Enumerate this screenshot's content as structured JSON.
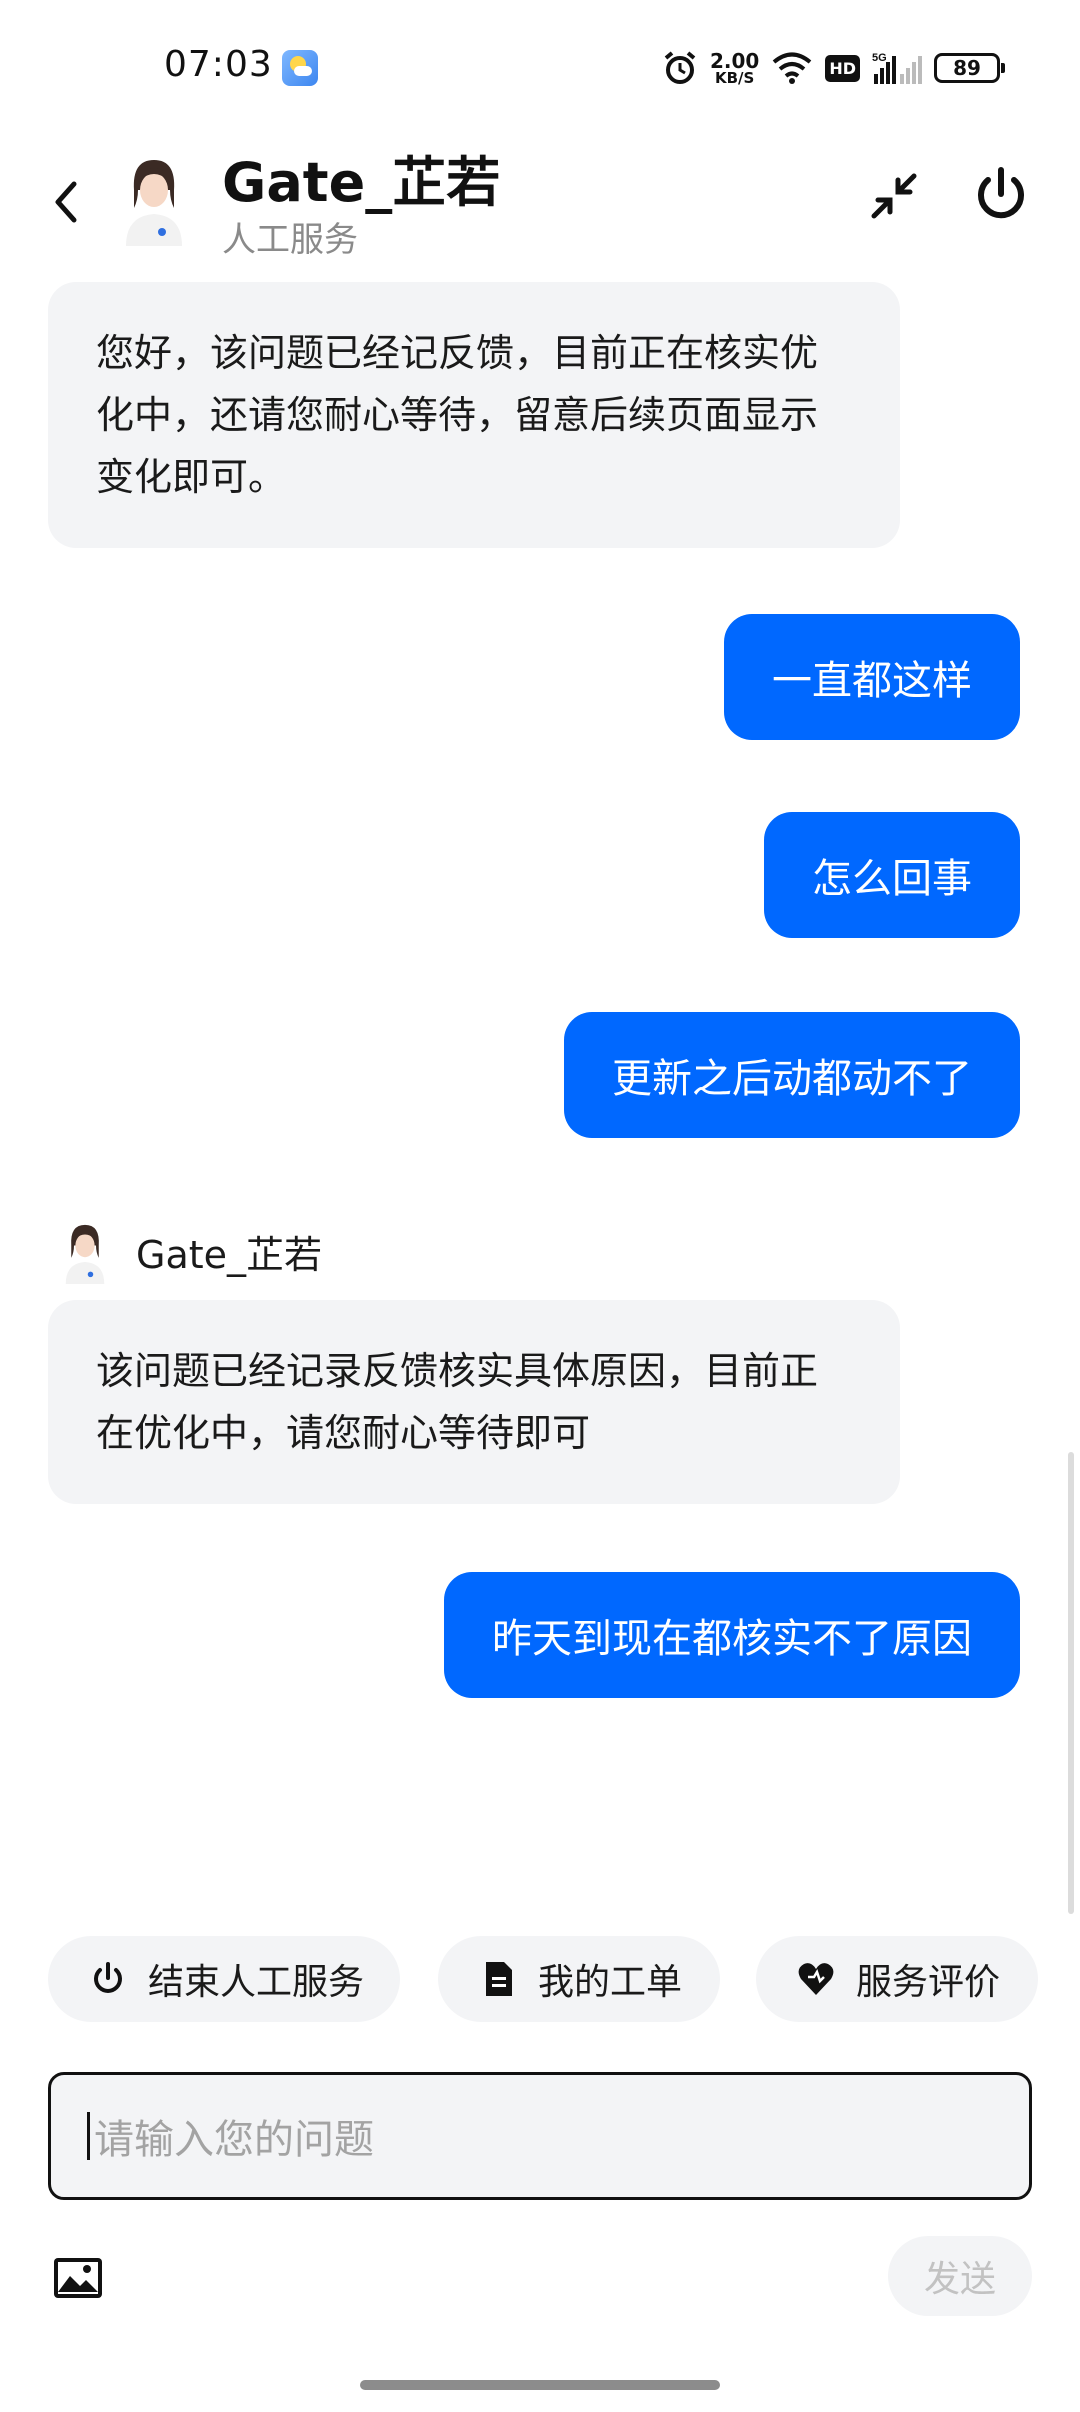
{
  "status_bar": {
    "time": "07:03",
    "speed_value": "2.00",
    "speed_unit": "KB/S",
    "hd_label": "HD",
    "network": "5G",
    "battery": "89"
  },
  "header": {
    "title": "Gate_芷若",
    "subtitle": "人工服务"
  },
  "messages": [
    {
      "side": "left",
      "text": "您好，该问题已经记反馈，目前正在核实优化中，还请您耐心等待，留意后续页面显示变化即可。"
    },
    {
      "side": "right",
      "text": "一直都这样"
    },
    {
      "side": "right",
      "text": "怎么回事"
    },
    {
      "side": "right",
      "text": "更新之后动都动不了"
    },
    {
      "side": "left",
      "sender": "Gate_芷若",
      "text": "该问题已经记录反馈核实具体原因，目前正在优化中，请您耐心等待即可"
    },
    {
      "side": "right",
      "text": "昨天到现在都核实不了原因"
    }
  ],
  "quick_actions": [
    {
      "label": "结束人工服务",
      "icon": "power-icon"
    },
    {
      "label": "我的工单",
      "icon": "document-icon"
    },
    {
      "label": "服务评价",
      "icon": "heart-icon"
    }
  ],
  "input": {
    "placeholder": "请输入您的问题",
    "send_label": "发送"
  },
  "colors": {
    "accent": "#0068ff",
    "bubble_left": "#f3f4f6",
    "text": "#111111"
  }
}
